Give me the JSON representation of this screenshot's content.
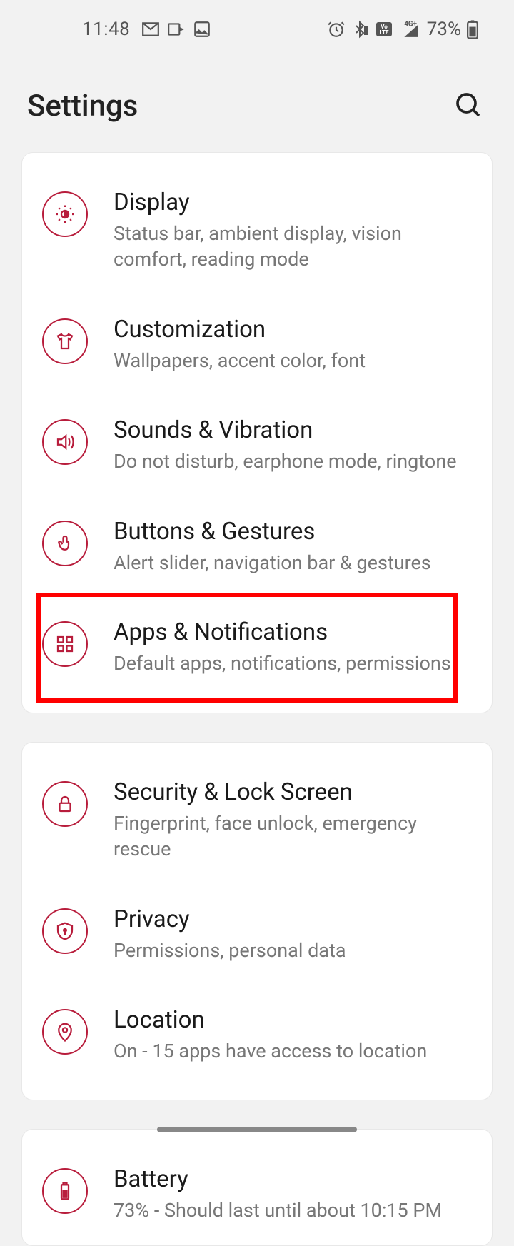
{
  "status": {
    "time": "11:48",
    "battery_text": "73%"
  },
  "header": {
    "title": "Settings"
  },
  "group1": [
    {
      "title": "Display",
      "subtitle": "Status bar, ambient display, vision comfort, reading mode"
    },
    {
      "title": "Customization",
      "subtitle": "Wallpapers, accent color, font"
    },
    {
      "title": "Sounds & Vibration",
      "subtitle": "Do not disturb, earphone mode, ringtone"
    },
    {
      "title": "Buttons & Gestures",
      "subtitle": "Alert slider, navigation bar & gestures"
    },
    {
      "title": "Apps & Notifications",
      "subtitle": "Default apps, notifications, permissions"
    }
  ],
  "group2": [
    {
      "title": "Security & Lock Screen",
      "subtitle": "Fingerprint, face unlock, emergency rescue"
    },
    {
      "title": "Privacy",
      "subtitle": "Permissions, personal data"
    },
    {
      "title": "Location",
      "subtitle": "On - 15 apps have access to location"
    }
  ],
  "group3": [
    {
      "title": "Battery",
      "subtitle": "73% - Should last until about 10:15 PM"
    }
  ]
}
